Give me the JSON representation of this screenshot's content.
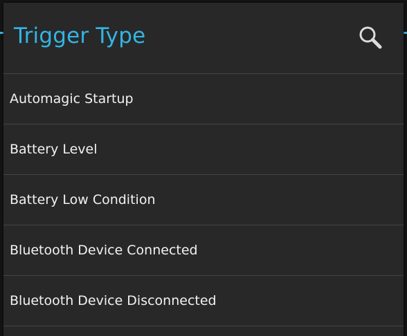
{
  "dialog": {
    "title": "Trigger Type",
    "search_icon": "search-icon",
    "accent_color": "#33b5e5"
  },
  "list": {
    "items": [
      {
        "label": "Automagic Startup"
      },
      {
        "label": "Battery Level"
      },
      {
        "label": "Battery Low Condition"
      },
      {
        "label": "Bluetooth Device Connected"
      },
      {
        "label": "Bluetooth Device Disconnected"
      }
    ]
  }
}
